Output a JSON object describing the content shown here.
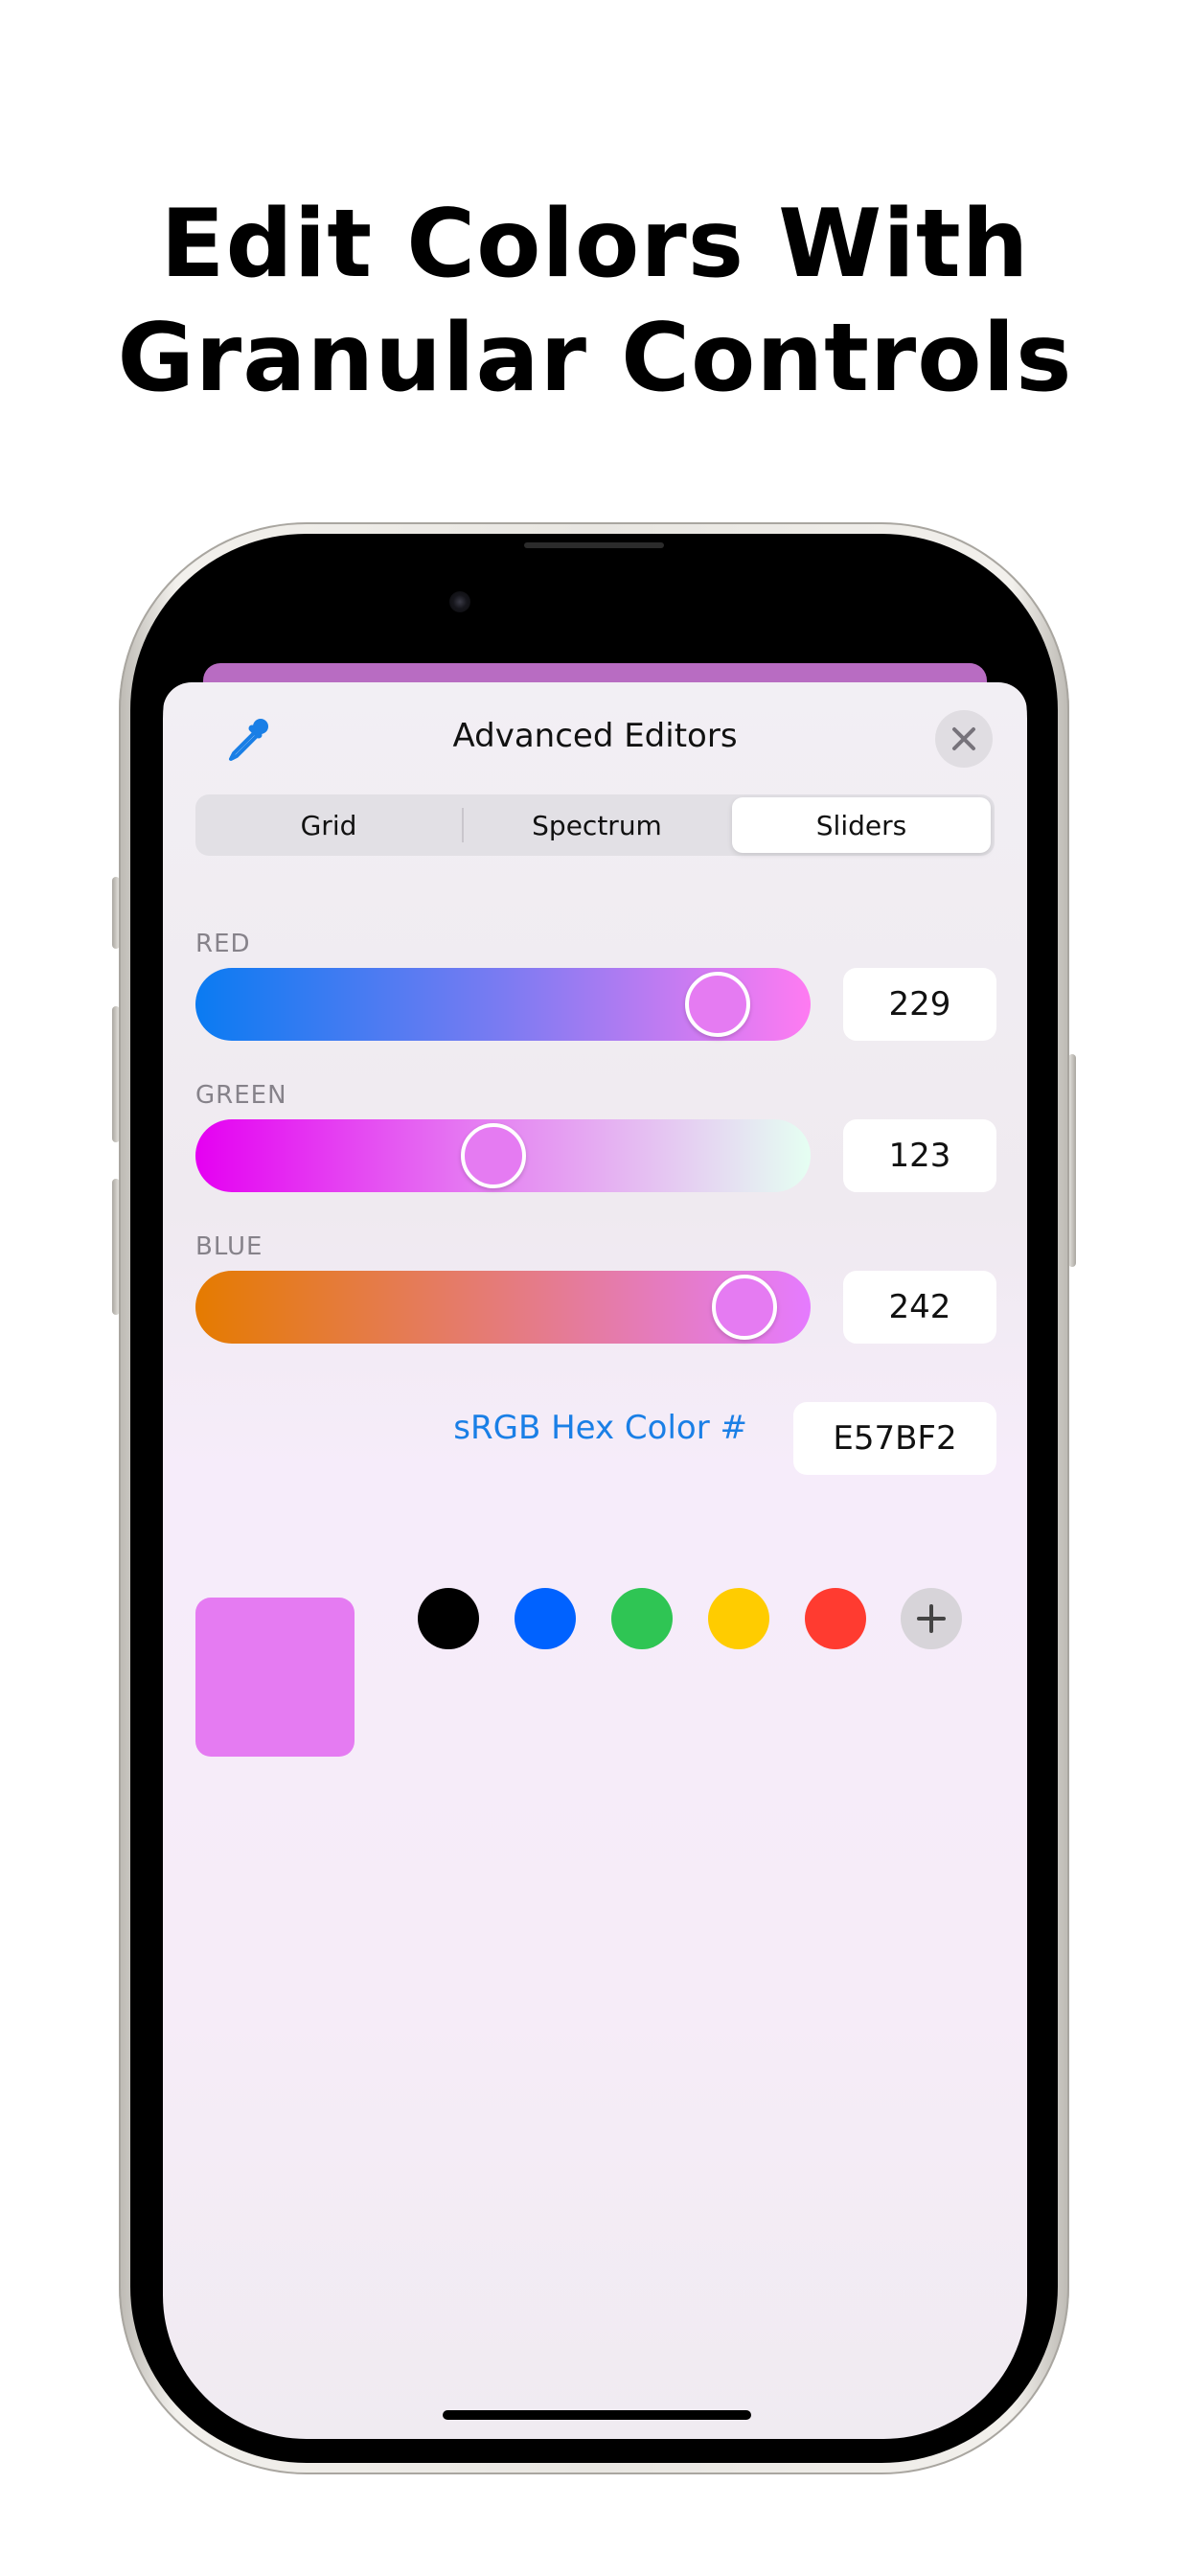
{
  "headline": {
    "line1": "Edit Colors With",
    "line2": "Granular Controls"
  },
  "sheet": {
    "title": "Advanced Editors",
    "tabs": [
      {
        "label": "Grid",
        "selected": false
      },
      {
        "label": "Spectrum",
        "selected": false
      },
      {
        "label": "Sliders",
        "selected": true
      }
    ]
  },
  "channels": [
    {
      "label": "RED",
      "value": "229",
      "fraction": 0.898
    },
    {
      "label": "GREEN",
      "value": "123",
      "fraction": 0.482
    },
    {
      "label": "BLUE",
      "value": "242",
      "fraction": 0.949
    }
  ],
  "hex": {
    "label": "sRGB Hex Color #",
    "value": "E57BF2"
  },
  "colors": {
    "current": "#e57bf2",
    "accent": "#1a7fe6",
    "swatches": [
      "#000000",
      "#0062ff",
      "#2fc554",
      "#ffcc00",
      "#ff3b30"
    ]
  },
  "icons": {
    "eyedropper": "eyedropper-icon",
    "close": "close-icon",
    "add": "plus-icon"
  }
}
